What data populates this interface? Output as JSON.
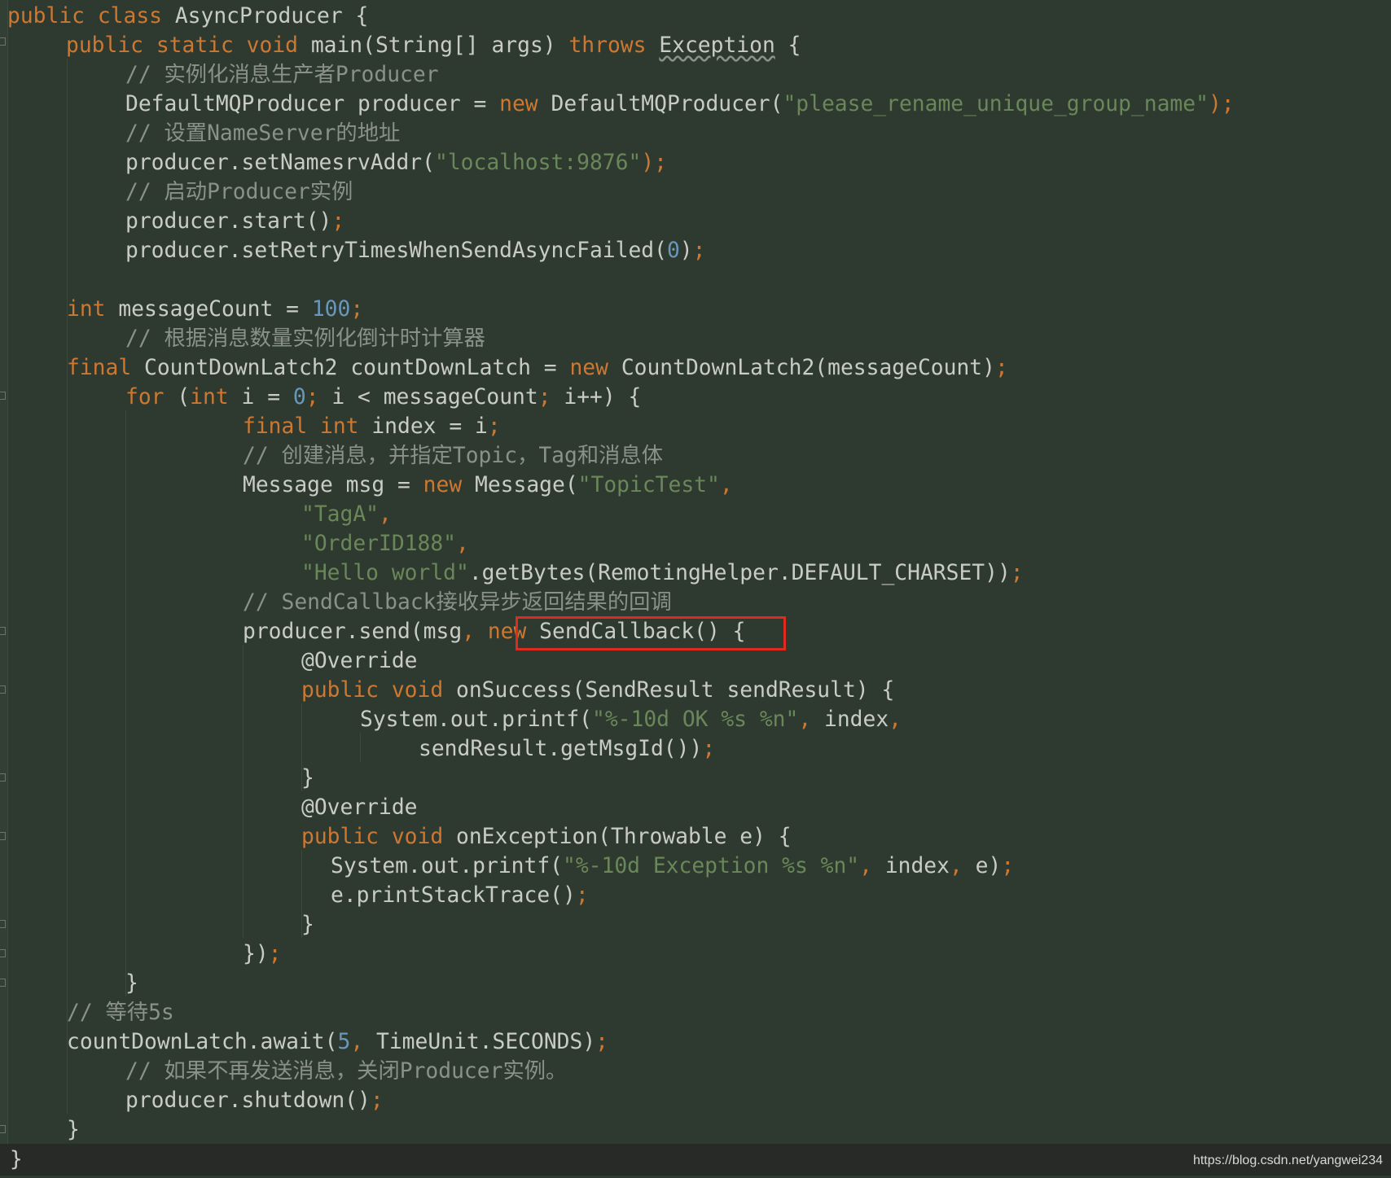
{
  "code": {
    "l1_a": "public class ",
    "l1_b": "AsyncProducer {",
    "l2_a": "public static void ",
    "l2_b": "main(String[] args) ",
    "l2_c": "throws ",
    "l2_d": "Exception",
    "l2_e": " {",
    "l3_a": "// ",
    "l3_b": "实例化消息生产者",
    "l3_c": "Producer",
    "l4_a": "DefaultMQProducer producer = ",
    "l4_b": "new ",
    "l4_c": "DefaultMQProducer(",
    "l4_d": "\"please_rename_unique_group_name\"",
    "l4_e": ");",
    "l5_a": "// ",
    "l5_b": "设置",
    "l5_c": "NameServer",
    "l5_d": "的地址",
    "l6_a": "producer.setNamesrvAddr(",
    "l6_b": "\"localhost:9876\"",
    "l6_c": ");",
    "l7_a": "// ",
    "l7_b": "启动",
    "l7_c": "Producer",
    "l7_d": "实例",
    "l8_a": "producer.start()",
    "l8_b": ";",
    "l9_a": "producer.setRetryTimesWhenSendAsyncFailed(",
    "l9_b": "0",
    "l9_c": ")",
    "l9_d": ";",
    "l11_a": "int ",
    "l11_b": "messageCount = ",
    "l11_c": "100",
    "l11_d": ";",
    "l12_a": "// ",
    "l12_b": "根据消息数量实例化倒计时计算器",
    "l13_a": "final ",
    "l13_b": "CountDownLatch2 countDownLatch = ",
    "l13_c": "new ",
    "l13_d": "CountDownLatch2(messageCount)",
    "l13_e": ";",
    "l14_a": "for ",
    "l14_b": "(",
    "l14_c": "int ",
    "l14_d": "i = ",
    "l14_e": "0",
    "l14_f": "; ",
    "l14_g": "i < messageCount",
    "l14_h": "; ",
    "l14_i": "i++) {",
    "l15_a": "final int ",
    "l15_b": "index = i",
    "l15_c": ";",
    "l16_a": "// ",
    "l16_b": "创建消息，并指定",
    "l16_c": "Topic",
    "l16_d": "，",
    "l16_e": "Tag",
    "l16_f": "和消息体",
    "l17_a": "Message msg = ",
    "l17_b": "new ",
    "l17_c": "Message(",
    "l17_d": "\"TopicTest\"",
    "l17_e": ",",
    "l18_a": "\"TagA\"",
    "l18_b": ",",
    "l19_a": "\"OrderID188\"",
    "l19_b": ",",
    "l20_a": "\"Hello world\"",
    "l20_b": ".getBytes(RemotingHelper.",
    "l20_c": "DEFAULT_CHARSET",
    "l20_d": "))",
    "l20_e": ";",
    "l21_a": "// SendCallback",
    "l21_b": "接收异步返回结果的回调",
    "l22_a": "producer.send(msg",
    "l22_b": ", ",
    "l22_c": "new ",
    "l22_d": "SendCallback()",
    "l22_e": " {",
    "l23_a": "@Override",
    "l24_a": "public void ",
    "l24_b": "onSuccess(SendResult sendResult) {",
    "l25_a": "System.",
    "l25_b": "out",
    "l25_c": ".printf(",
    "l25_d": "\"%-10d OK %s %n\"",
    "l25_e": ", ",
    "l25_f": "index",
    "l25_g": ",",
    "l26_a": "sendResult.getMsgId())",
    "l26_b": ";",
    "l27_a": "}",
    "l28_a": "@Override",
    "l29_a": "public void ",
    "l29_b": "onException(Throwable e) {",
    "l30_a": "System.",
    "l30_b": "out",
    "l30_c": ".printf(",
    "l30_d": "\"%-10d Exception %s %n\"",
    "l30_e": ", ",
    "l30_f": "index",
    "l30_g": ", ",
    "l30_h": "e)",
    "l30_i": ";",
    "l31_a": "e.printStackTrace()",
    "l31_b": ";",
    "l32_a": "}",
    "l33_a": "})",
    "l33_b": ";",
    "l34_a": "}",
    "l35_a": "// ",
    "l35_b": "等待",
    "l35_c": "5s",
    "l36_a": "countDownLatch.await(",
    "l36_b": "5",
    "l36_c": ", ",
    "l36_d": "TimeUnit.",
    "l36_e": "SECONDS",
    "l36_f": ")",
    "l36_g": ";",
    "l37_a": "// ",
    "l37_b": "如果不再发送消息，关闭",
    "l37_c": "Producer",
    "l37_d": "实例。",
    "l38_a": "producer.shutdown()",
    "l38_b": ";",
    "l39_a": "}"
  },
  "footer": {
    "closing_brace": "}",
    "watermark": "https://blog.csdn.net/yangwei234"
  },
  "colors": {
    "background": "#2e3a30",
    "keyword": "#cc7832",
    "string": "#6a8759",
    "number": "#6897bb",
    "comment": "#8a9187",
    "annotation": "#bbb529",
    "highlight_box": "#e02a20"
  }
}
